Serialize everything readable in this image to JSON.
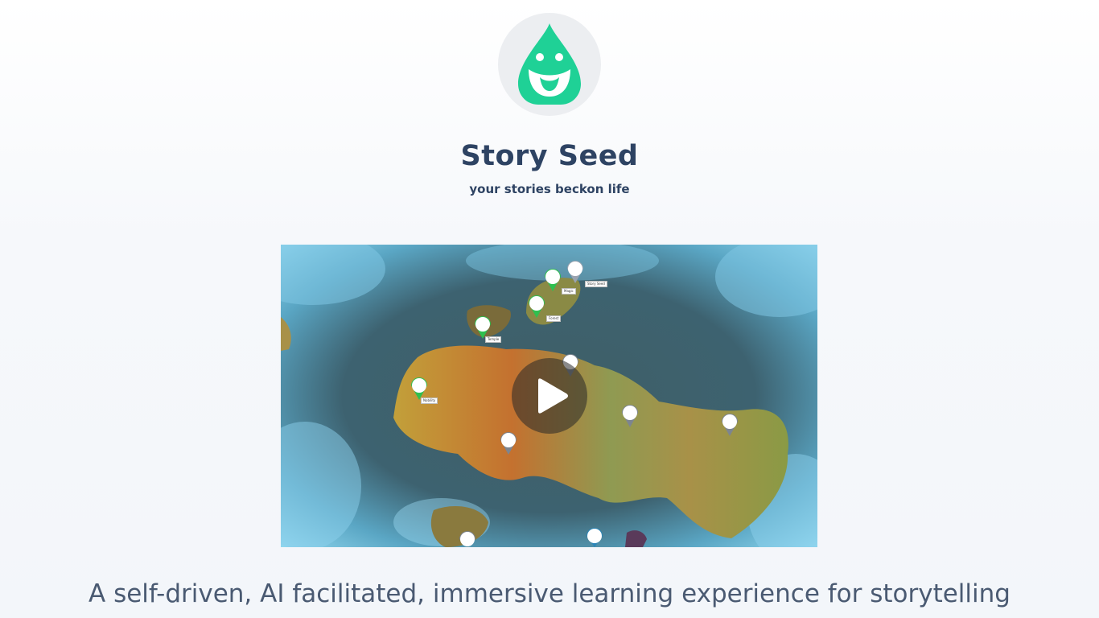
{
  "brand": {
    "name": "Story Seed",
    "tagline": "your stories beckon life",
    "accent_color": "#1fd196",
    "title_color": "#2e4363"
  },
  "video": {
    "play_icon": "play-icon",
    "map_labels": [
      "Story Seed",
      "Magic",
      "Forest",
      "Temple",
      "Nobility"
    ]
  },
  "intro": {
    "headline": "A self-driven, AI facilitated, immersive learning experience for storytelling"
  }
}
